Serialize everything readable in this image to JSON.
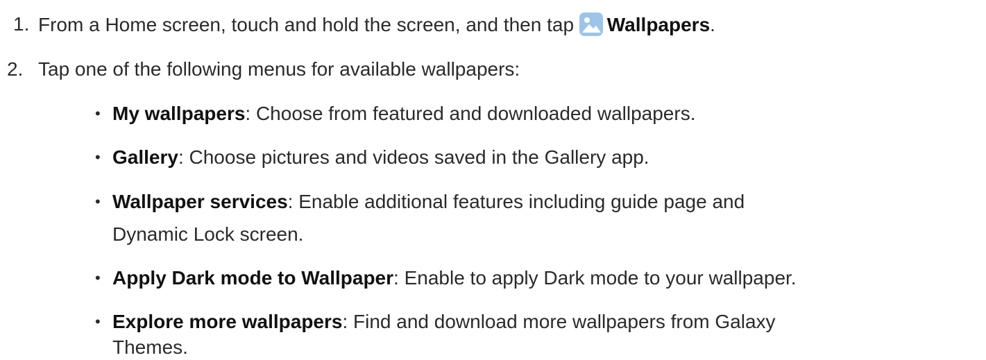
{
  "steps": [
    {
      "number": "1.",
      "text_before": "From a Home screen, touch and hold the screen, and then tap",
      "icon": "wallpapers-icon",
      "bold_text": "Wallpapers",
      "text_after": "."
    },
    {
      "number": "2.",
      "text": "Tap one of the following menus for available wallpapers:"
    }
  ],
  "bullets": [
    {
      "title": "My wallpapers",
      "description": ": Choose from featured and downloaded wallpapers."
    },
    {
      "title": "Gallery",
      "description": ": Choose pictures and videos saved in the Gallery app."
    },
    {
      "title": "Wallpaper services",
      "description": ": Enable additional features including guide page and",
      "continuation": "Dynamic Lock screen."
    },
    {
      "title": "Apply Dark mode to Wallpaper",
      "description": ": Enable to apply Dark mode to your wallpaper."
    },
    {
      "title": "Explore more wallpapers",
      "description": ": Find and download more wallpapers from Galaxy",
      "continuation": "Themes."
    }
  ],
  "bullet_glyph": "•",
  "colors": {
    "icon_background": "#9ec5e8",
    "icon_mountain": "#ffffff"
  }
}
